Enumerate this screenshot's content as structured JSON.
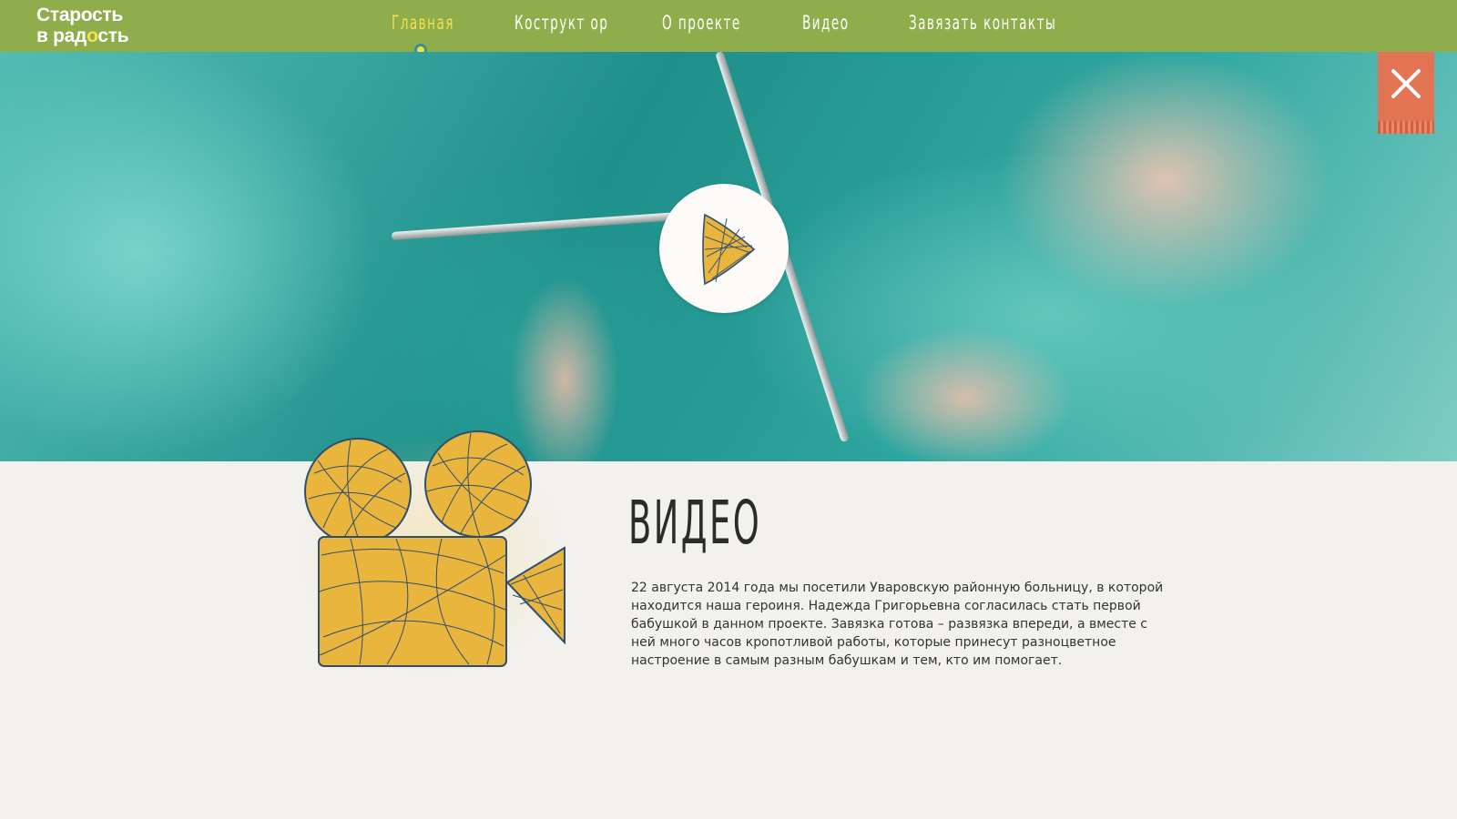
{
  "header": {
    "logo": {
      "line1": "Старость",
      "line2_a": "в рад",
      "line2_sun": "о",
      "line2_b": "сть"
    },
    "nav": [
      {
        "label": "Главная",
        "active": true
      },
      {
        "label": "Кострукт ор",
        "active": false
      },
      {
        "label": "О проекте",
        "active": false
      },
      {
        "label": "Видео",
        "active": false
      },
      {
        "label": "Завязать контакты",
        "active": false
      }
    ]
  },
  "hero": {
    "play_icon": "yarn-triangle-play-icon",
    "close_icon": "close-icon"
  },
  "content": {
    "title": "ВИДЕО",
    "description": "22 августа 2014 года мы посетили Уваровскую районную больницу, в которой находится наша героиня. Надежда Григорьевна согласилась стать первой бабушкой в данном проекте. Завязка готова – развязка впереди, а вместе с ней много часов кропотливой работы, которые принесут разноцветное настроение в самым разным бабушкам и тем, кто им помогает."
  },
  "colors": {
    "header_bg": "#8fad4a",
    "nav_active": "#ede24e",
    "close_bg": "#e27453",
    "yarn_yellow": "#e9b53c"
  }
}
